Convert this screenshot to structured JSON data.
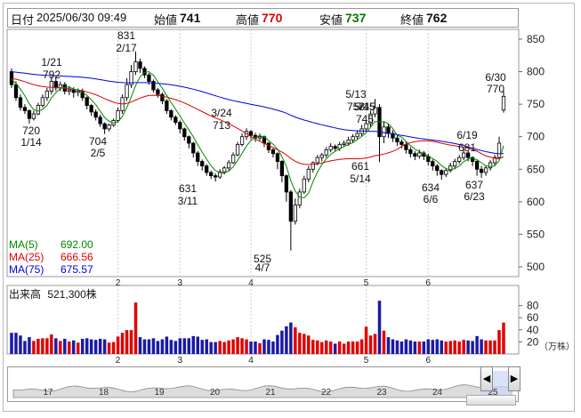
{
  "header": {
    "date_label": "日付",
    "datetime": "2025/06/30 09:49",
    "open_label": "始値",
    "open_value": "741",
    "high_label": "高値",
    "high_value": "770",
    "low_label": "安値",
    "low_value": "737",
    "close_label": "終値",
    "close_value": "762",
    "colors": {
      "high": "#e00000",
      "low": "#007700"
    }
  },
  "legend": {
    "ma5_label": "MA(5)",
    "ma5_value": "692.00",
    "ma25_label": "MA(25)",
    "ma25_value": "666.56",
    "ma75_label": "MA(75)",
    "ma75_value": "675.57"
  },
  "volume_panel": {
    "title": "出来高",
    "value": "521,300株",
    "unit": "（万株）",
    "y_ticks": [
      "80",
      "60",
      "40",
      "20"
    ]
  },
  "month_labels": [
    "2",
    "3",
    "4",
    "5",
    "6"
  ],
  "navigator": {
    "week_labels": [
      "17",
      "18",
      "19",
      "20",
      "21",
      "22",
      "23",
      "24",
      "25"
    ],
    "left_arrow": "◀",
    "right_arrow": "▶"
  },
  "colors": {
    "ma5": "#008800",
    "ma25": "#dd0000",
    "ma75": "#0000dd",
    "volume_up": "#e00000",
    "volume_down": "#1a1aa6",
    "volume_highlight": "#e00000"
  },
  "chart_data": {
    "type": "candlestick",
    "ylim": [
      485,
      865
    ],
    "y_ticks": [
      850,
      800,
      750,
      700,
      650,
      600,
      550,
      500
    ],
    "annotations": [
      {
        "label": "831",
        "date": "2/17",
        "value": 831
      },
      {
        "label": "792",
        "date": "1/21",
        "value": 792
      },
      {
        "label": "720",
        "date": "1/14",
        "value": 720
      },
      {
        "label": "704",
        "date": "2/5",
        "value": 704
      },
      {
        "label": "713",
        "date": "3/24",
        "value": 713
      },
      {
        "label": "631",
        "date": "3/11",
        "value": 631
      },
      {
        "label": "525",
        "date": "4/7",
        "value": 525
      },
      {
        "label": "758",
        "date": "5/13",
        "value": 758
      },
      {
        "label": "745",
        "date": "5/15",
        "value": 745
      },
      {
        "label": "724",
        "date": "5/15",
        "value": 724
      },
      {
        "label": "661",
        "date": "5/14",
        "value": 661
      },
      {
        "label": "681",
        "date": "6/19",
        "value": 681
      },
      {
        "label": "634",
        "date": "6/6",
        "value": 634
      },
      {
        "label": "637",
        "date": "6/23",
        "value": 637
      },
      {
        "label": "770",
        "date": "6/30",
        "value": 770
      }
    ],
    "candles": [
      [
        800,
        780,
        805,
        775
      ],
      [
        780,
        760,
        785,
        755
      ],
      [
        760,
        745,
        765,
        740
      ],
      [
        745,
        740,
        750,
        735
      ],
      [
        740,
        728,
        742,
        720
      ],
      [
        728,
        735,
        740,
        725
      ],
      [
        735,
        748,
        752,
        733
      ],
      [
        748,
        760,
        765,
        745
      ],
      [
        760,
        770,
        775,
        755
      ],
      [
        770,
        785,
        792,
        765
      ],
      [
        785,
        775,
        790,
        770
      ],
      [
        775,
        780,
        785,
        770
      ],
      [
        780,
        770,
        784,
        765
      ],
      [
        770,
        772,
        778,
        764
      ],
      [
        772,
        768,
        776,
        760
      ],
      [
        768,
        770,
        774,
        762
      ],
      [
        770,
        760,
        774,
        755
      ],
      [
        760,
        748,
        762,
        742
      ],
      [
        748,
        738,
        750,
        732
      ],
      [
        738,
        730,
        742,
        725
      ],
      [
        730,
        720,
        734,
        715
      ],
      [
        720,
        712,
        722,
        704
      ],
      [
        712,
        718,
        720,
        708
      ],
      [
        718,
        725,
        728,
        715
      ],
      [
        725,
        740,
        745,
        722
      ],
      [
        740,
        760,
        765,
        735
      ],
      [
        760,
        780,
        790,
        755
      ],
      [
        780,
        800,
        810,
        775
      ],
      [
        800,
        815,
        831,
        795
      ],
      [
        815,
        805,
        820,
        798
      ],
      [
        805,
        795,
        808,
        790
      ],
      [
        795,
        785,
        798,
        780
      ],
      [
        785,
        772,
        788,
        768
      ],
      [
        772,
        765,
        775,
        760
      ],
      [
        765,
        755,
        768,
        750
      ],
      [
        755,
        740,
        758,
        735
      ],
      [
        740,
        730,
        742,
        725
      ],
      [
        730,
        722,
        733,
        718
      ],
      [
        722,
        712,
        725,
        705
      ],
      [
        712,
        700,
        714,
        694
      ],
      [
        700,
        690,
        702,
        682
      ],
      [
        690,
        675,
        692,
        668
      ],
      [
        675,
        662,
        678,
        655
      ],
      [
        662,
        655,
        665,
        648
      ],
      [
        655,
        645,
        658,
        640
      ],
      [
        645,
        640,
        648,
        635
      ],
      [
        640,
        638,
        644,
        631
      ],
      [
        638,
        646,
        650,
        635
      ],
      [
        646,
        652,
        655,
        642
      ],
      [
        652,
        660,
        664,
        648
      ],
      [
        660,
        672,
        676,
        658
      ],
      [
        672,
        688,
        692,
        670
      ],
      [
        688,
        700,
        705,
        685
      ],
      [
        700,
        708,
        713,
        695
      ],
      [
        708,
        702,
        710,
        696
      ],
      [
        702,
        698,
        706,
        692
      ],
      [
        698,
        700,
        705,
        694
      ],
      [
        700,
        690,
        702,
        684
      ],
      [
        690,
        680,
        692,
        675
      ],
      [
        680,
        674,
        682,
        668
      ],
      [
        674,
        662,
        676,
        650
      ],
      [
        662,
        640,
        664,
        630
      ],
      [
        640,
        615,
        642,
        600
      ],
      [
        615,
        570,
        618,
        525
      ],
      [
        570,
        595,
        605,
        565
      ],
      [
        595,
        615,
        620,
        590
      ],
      [
        615,
        635,
        640,
        612
      ],
      [
        635,
        650,
        655,
        630
      ],
      [
        650,
        660,
        662,
        645
      ],
      [
        660,
        668,
        672,
        656
      ],
      [
        668,
        672,
        675,
        662
      ],
      [
        672,
        680,
        684,
        668
      ],
      [
        680,
        685,
        690,
        676
      ],
      [
        685,
        682,
        688,
        678
      ],
      [
        682,
        688,
        692,
        678
      ],
      [
        688,
        690,
        694,
        684
      ],
      [
        690,
        695,
        700,
        686
      ],
      [
        695,
        700,
        704,
        690
      ],
      [
        700,
        705,
        710,
        696
      ],
      [
        705,
        712,
        718,
        700
      ],
      [
        712,
        720,
        725,
        708
      ],
      [
        720,
        735,
        740,
        715
      ],
      [
        735,
        745,
        758,
        730
      ],
      [
        745,
        700,
        750,
        661
      ],
      [
        700,
        715,
        724,
        690
      ],
      [
        715,
        705,
        720,
        698
      ],
      [
        705,
        698,
        710,
        692
      ],
      [
        698,
        692,
        702,
        686
      ],
      [
        692,
        688,
        696,
        682
      ],
      [
        688,
        680,
        692,
        674
      ],
      [
        680,
        674,
        684,
        668
      ],
      [
        674,
        670,
        678,
        664
      ],
      [
        670,
        675,
        680,
        666
      ],
      [
        675,
        670,
        678,
        664
      ],
      [
        670,
        662,
        674,
        656
      ],
      [
        662,
        655,
        665,
        648
      ],
      [
        655,
        648,
        658,
        640
      ],
      [
        648,
        642,
        650,
        634
      ],
      [
        642,
        648,
        652,
        638
      ],
      [
        648,
        655,
        660,
        645
      ],
      [
        655,
        662,
        666,
        650
      ],
      [
        662,
        668,
        672,
        658
      ],
      [
        668,
        675,
        681,
        664
      ],
      [
        675,
        668,
        678,
        662
      ],
      [
        668,
        662,
        670,
        655
      ],
      [
        662,
        650,
        664,
        640
      ],
      [
        650,
        645,
        655,
        637
      ],
      [
        645,
        652,
        656,
        640
      ],
      [
        652,
        660,
        664,
        648
      ],
      [
        660,
        668,
        672,
        656
      ],
      [
        668,
        690,
        700,
        665
      ],
      [
        741,
        762,
        770,
        737
      ]
    ]
  }
}
